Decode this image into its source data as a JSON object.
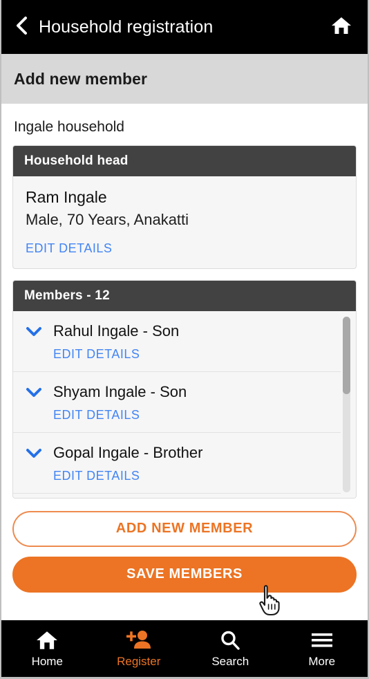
{
  "appbar": {
    "back_icon": "chevron-left-icon",
    "title": "Household registration",
    "home_icon": "home-icon"
  },
  "subheader": {
    "title": "Add new member"
  },
  "main": {
    "household_title": "Ingale household",
    "head_card": {
      "header": "Household head",
      "name": "Ram Ingale",
      "meta": "Male, 70 Years, Anakatti",
      "edit_label": "EDIT DETAILS"
    },
    "members_card": {
      "header": "Members - 12",
      "edit_label": "EDIT DETAILS",
      "rows": [
        {
          "name": "Rahul Ingale - Son",
          "edit_label": "EDIT DETAILS",
          "chevron": "chevron-down-icon"
        },
        {
          "name": "Shyam Ingale - Son",
          "edit_label": "EDIT DETAILS",
          "chevron": "chevron-down-icon"
        },
        {
          "name": "Gopal Ingale - Brother",
          "edit_label": "EDIT DETAILS",
          "chevron": "chevron-down-icon"
        }
      ]
    },
    "actions": {
      "add_label": "ADD NEW MEMBER",
      "save_label": "SAVE MEMBERS"
    }
  },
  "bottomnav": {
    "items": [
      {
        "label": "Home",
        "icon": "home-icon",
        "active": false
      },
      {
        "label": "Register",
        "icon": "add-person-icon",
        "active": true
      },
      {
        "label": "Search",
        "icon": "search-icon",
        "active": false
      },
      {
        "label": "More",
        "icon": "hamburger-menu-icon",
        "active": false
      }
    ]
  },
  "colors": {
    "accent_orange": "#ec7424",
    "link_blue": "#4285f4",
    "card_header_gray": "#424242",
    "card_body_gray": "#f6f6f6",
    "subheader_gray": "#d8d8d8",
    "bar_black": "#000000"
  },
  "cursor": {
    "type": "pointer-hand-cursor"
  }
}
